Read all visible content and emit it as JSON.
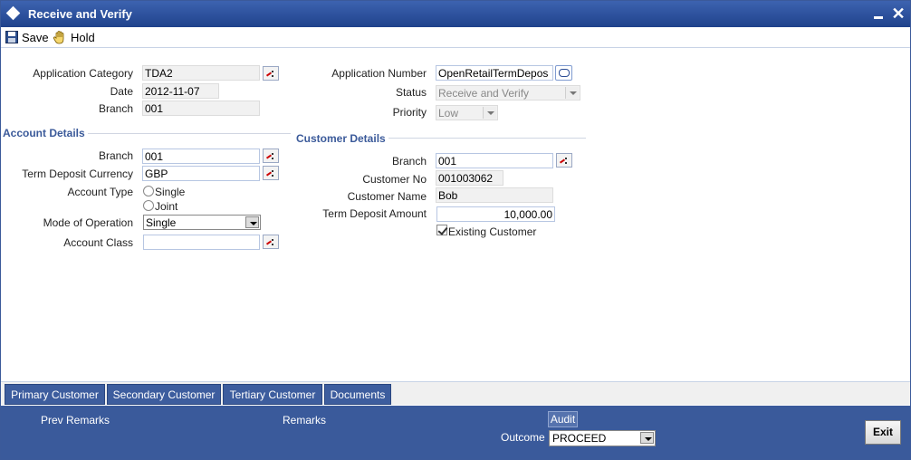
{
  "window": {
    "title": "Receive and Verify"
  },
  "toolbar": {
    "save_label": "Save",
    "hold_label": "Hold"
  },
  "header": {
    "application_category_label": "Application Category",
    "application_category": "TDA2",
    "date_label": "Date",
    "date": "2012-11-07",
    "branch_label": "Branch",
    "branch": "001",
    "application_number_label": "Application Number",
    "application_number": "OpenRetailTermDepos",
    "status_label": "Status",
    "status": "Receive and Verify",
    "priority_label": "Priority",
    "priority": "Low"
  },
  "account_details": {
    "section_title": "Account Details",
    "branch_label": "Branch",
    "branch": "001",
    "currency_label": "Term Deposit Currency",
    "currency": "GBP",
    "account_type_label": "Account Type",
    "account_type_options": [
      "Single",
      "Joint"
    ],
    "mode_of_operation_label": "Mode of Operation",
    "mode_of_operation": "Single",
    "account_class_label": "Account Class",
    "account_class": ""
  },
  "customer_details": {
    "section_title": "Customer Details",
    "branch_label": "Branch",
    "branch": "001",
    "customer_no_label": "Customer No",
    "customer_no": "001003062",
    "customer_name_label": "Customer Name",
    "customer_name": "Bob",
    "term_deposit_amount_label": "Term Deposit Amount",
    "term_deposit_amount": "10,000.00",
    "existing_customer_label": "Existing Customer",
    "existing_customer": true
  },
  "tabs": [
    {
      "label": "Primary Customer"
    },
    {
      "label": "Secondary Customer"
    },
    {
      "label": "Tertiary Customer"
    },
    {
      "label": "Documents"
    }
  ],
  "footer": {
    "prev_remarks_label": "Prev Remarks",
    "remarks_label": "Remarks",
    "audit_label": "Audit",
    "outcome_label": "Outcome",
    "outcome": "PROCEED",
    "exit_label": "Exit"
  },
  "colors": {
    "title_bar": "#20428c",
    "section_title": "#3b5a9a",
    "footer_bg": "#3a5a9b",
    "tab_bg": "#3d5d9e"
  }
}
